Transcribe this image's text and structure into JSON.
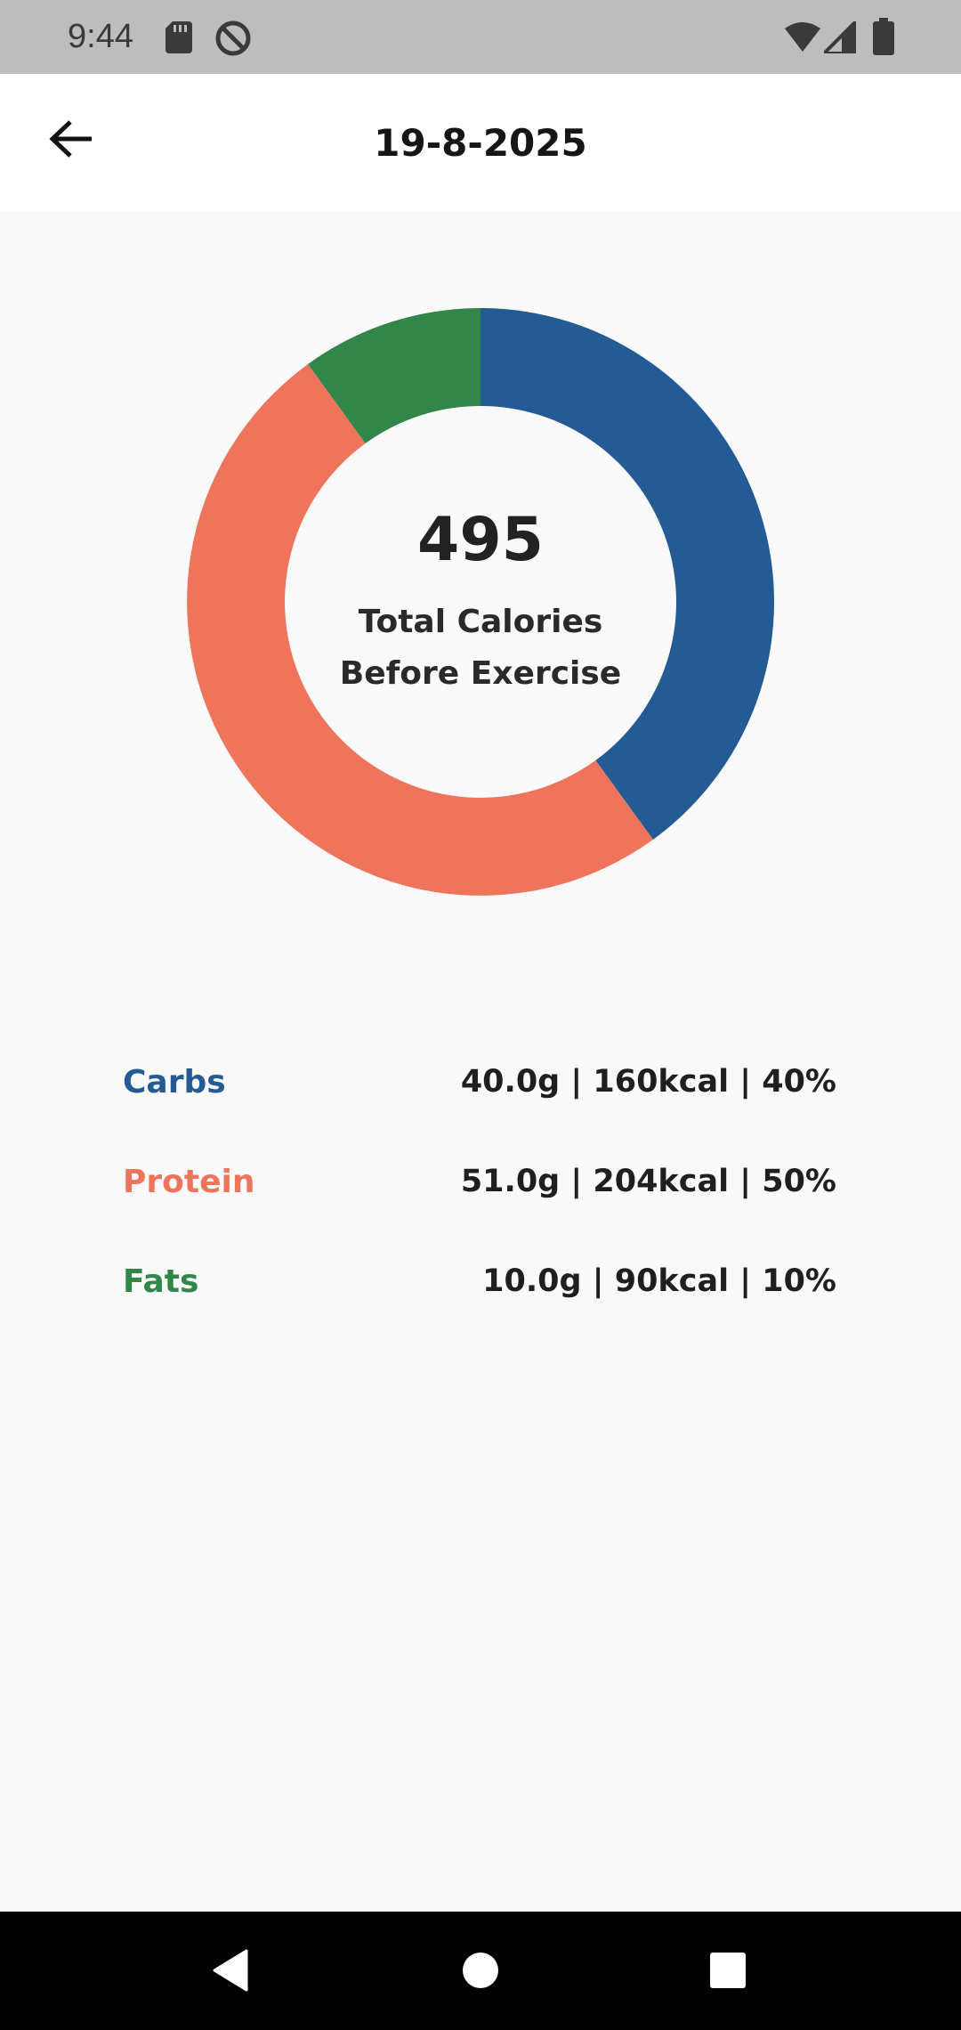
{
  "status_bar": {
    "time": "9:44",
    "left_icons": [
      "sd-card-icon",
      "do-not-disturb-icon"
    ],
    "right_icons": [
      "wifi-icon",
      "signal-icon",
      "battery-icon"
    ]
  },
  "header": {
    "back_icon": "arrow-left-icon",
    "title": "19-8-2025"
  },
  "summary": {
    "total": "495",
    "caption_line1": "Total Calories",
    "caption_line2": "Before Exercise"
  },
  "macros": [
    {
      "name": "Carbs",
      "value": "40.0g | 160kcal | 40%",
      "color": "#245b94"
    },
    {
      "name": "Protein",
      "value": "51.0g | 204kcal | 50%",
      "color": "#ee755b"
    },
    {
      "name": "Fats",
      "value": "10.0g | 90kcal | 10%",
      "color": "#31864a"
    }
  ],
  "chart_data": {
    "type": "pie",
    "categories": [
      "Carbs",
      "Protein",
      "Fats"
    ],
    "values": [
      40,
      50,
      10
    ],
    "colors": [
      "#245b94",
      "#ee755b",
      "#31864a"
    ]
  },
  "nav_bar": {
    "icons": [
      "back-triangle-icon",
      "home-circle-icon",
      "recents-square-icon"
    ]
  }
}
